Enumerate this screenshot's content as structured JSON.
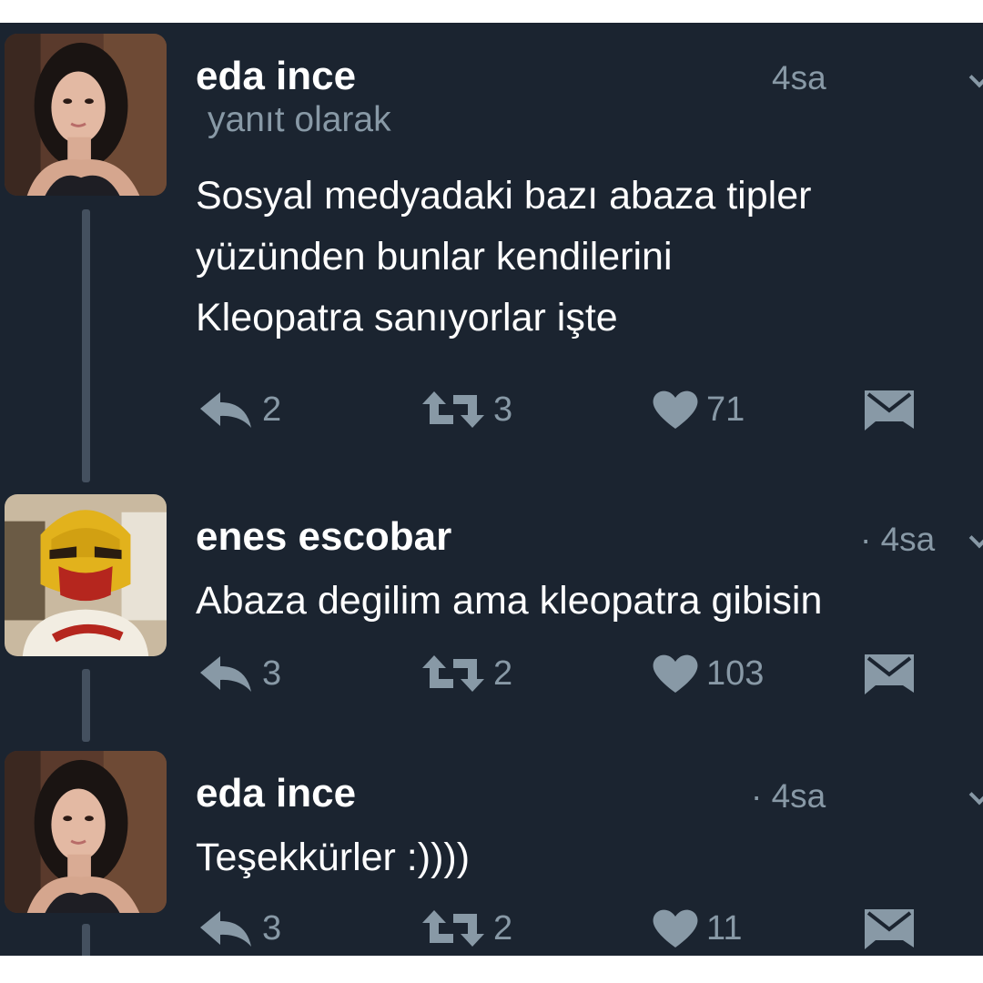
{
  "colors": {
    "background": "#1b2430",
    "text": "#ffffff",
    "muted": "#8899a6",
    "thread_line": "#44505f"
  },
  "tweets": [
    {
      "author": "eda ince",
      "time": "4sa",
      "reply_context": "yanıt olarak",
      "text_lines": [
        "Sosyal medyadaki bazı abaza tipler",
        "yüzünden bunlar kendilerini",
        "Kleopatra sanıyorlar işte"
      ],
      "actions": {
        "reply": "2",
        "retweet": "3",
        "like": "71"
      }
    },
    {
      "author": "enes escobar",
      "time": "· 4sa",
      "text_lines": [
        "Abaza degilim ama kleopatra gibisin"
      ],
      "actions": {
        "reply": "3",
        "retweet": "2",
        "like": "103"
      }
    },
    {
      "author": "eda ince",
      "time": "· 4sa",
      "text_lines": [
        "Teşekkürler :))))"
      ],
      "actions": {
        "reply": "3",
        "retweet": "2",
        "like": "11"
      }
    }
  ],
  "icons": {
    "reply": "reply-icon",
    "retweet": "retweet-icon",
    "like": "heart-icon",
    "message": "direct-message-icon",
    "more": "chevron-down-icon"
  }
}
